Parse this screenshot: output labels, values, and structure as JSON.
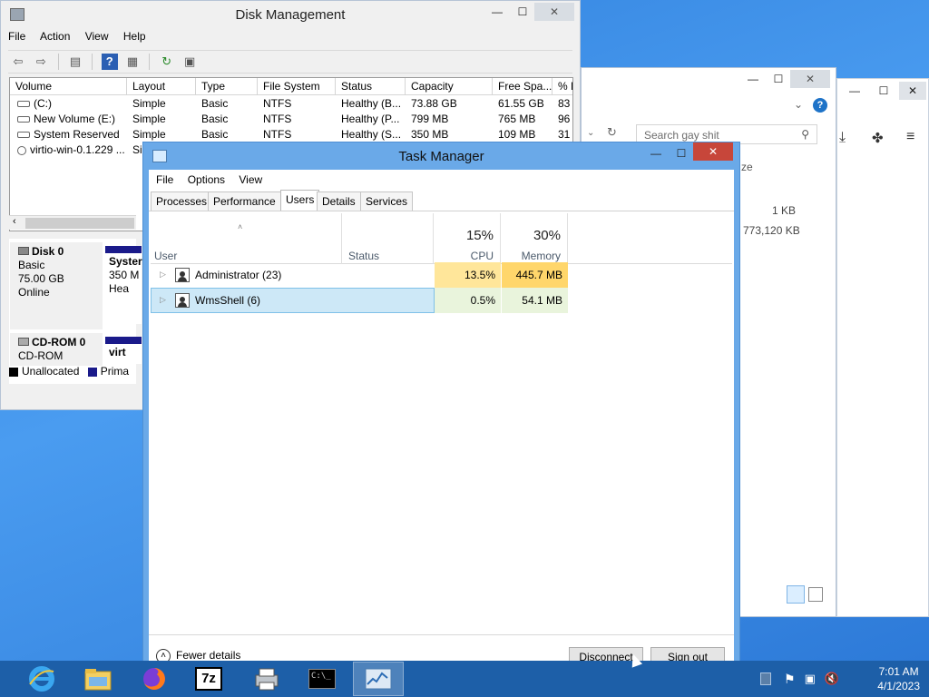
{
  "disk_management": {
    "title": "Disk Management",
    "menu": [
      "File",
      "Action",
      "View",
      "Help"
    ],
    "columns": [
      "Volume",
      "Layout",
      "Type",
      "File System",
      "Status",
      "Capacity",
      "Free Spa...",
      "% F"
    ],
    "rows": [
      [
        "(C:)",
        "Simple",
        "Basic",
        "NTFS",
        "Healthy (B...",
        "73.88 GB",
        "61.55 GB",
        "83"
      ],
      [
        "New Volume (E:)",
        "Simple",
        "Basic",
        "NTFS",
        "Healthy (P...",
        "799 MB",
        "765 MB",
        "96"
      ],
      [
        "System Reserved",
        "Simple",
        "Basic",
        "NTFS",
        "Healthy (S...",
        "350 MB",
        "109 MB",
        "31"
      ],
      [
        "virtio-win-0.1.229 ...",
        "Si",
        "",
        "",
        "",
        "",
        "",
        ""
      ]
    ],
    "disk0": {
      "name": "Disk 0",
      "type": "Basic",
      "size": "75.00 GB",
      "state": "Online",
      "vol_name": "Syster",
      "vol_size": "350 M",
      "vol_status": "Hea"
    },
    "cdrom0": {
      "name": "CD-ROM 0",
      "type": "CD-ROM",
      "vol_name": "virt"
    },
    "legend": {
      "unallocated": "Unallocated",
      "primary": "Prima"
    }
  },
  "explorer": {
    "search_placeholder": "Search gay shit",
    "col_fragment": "ze",
    "size1": "1 KB",
    "size2": "773,120 KB"
  },
  "task_manager": {
    "title": "Task Manager",
    "menu": [
      "File",
      "Options",
      "View"
    ],
    "tabs": [
      "Processes",
      "Performance",
      "Users",
      "Details",
      "Services"
    ],
    "active_tab": "Users",
    "headers": {
      "user": "User",
      "status": "Status",
      "cpu_pct": "15%",
      "cpu": "CPU",
      "mem_pct": "30%",
      "memory": "Memory"
    },
    "users": [
      {
        "name": "Administrator (23)",
        "cpu": "13.5%",
        "memory": "445.7 MB"
      },
      {
        "name": "WmsShell (6)",
        "cpu": "0.5%",
        "memory": "54.1 MB"
      }
    ],
    "fewer_details": "Fewer details",
    "disconnect": "Disconnect",
    "sign_out": "Sign out"
  },
  "taskbar": {
    "time": "7:01 AM",
    "date": "4/1/2023"
  },
  "colors": {
    "accent_blue": "#6aa9e8",
    "cpu_highlight": "#ffe69a",
    "mem_highlight": "#ffd66b",
    "selected_row": "#cde8f7",
    "close_red": "#c7463a"
  },
  "icons": [
    "disk-icon",
    "back-arrow-icon",
    "forward-arrow-icon",
    "help-icon",
    "refresh-icon",
    "properties-icon",
    "search-icon",
    "chevron-down-icon",
    "help-circle-icon",
    "download-icon",
    "extensions-icon",
    "menu-icon",
    "user-icon",
    "expand-arrow-icon",
    "collapse-arrow-icon",
    "ie-icon",
    "folder-icon",
    "firefox-icon",
    "7zip-icon",
    "printer-icon",
    "cmd-icon",
    "taskmanager-icon",
    "flag-icon",
    "network-icon",
    "volume-muted-icon"
  ]
}
